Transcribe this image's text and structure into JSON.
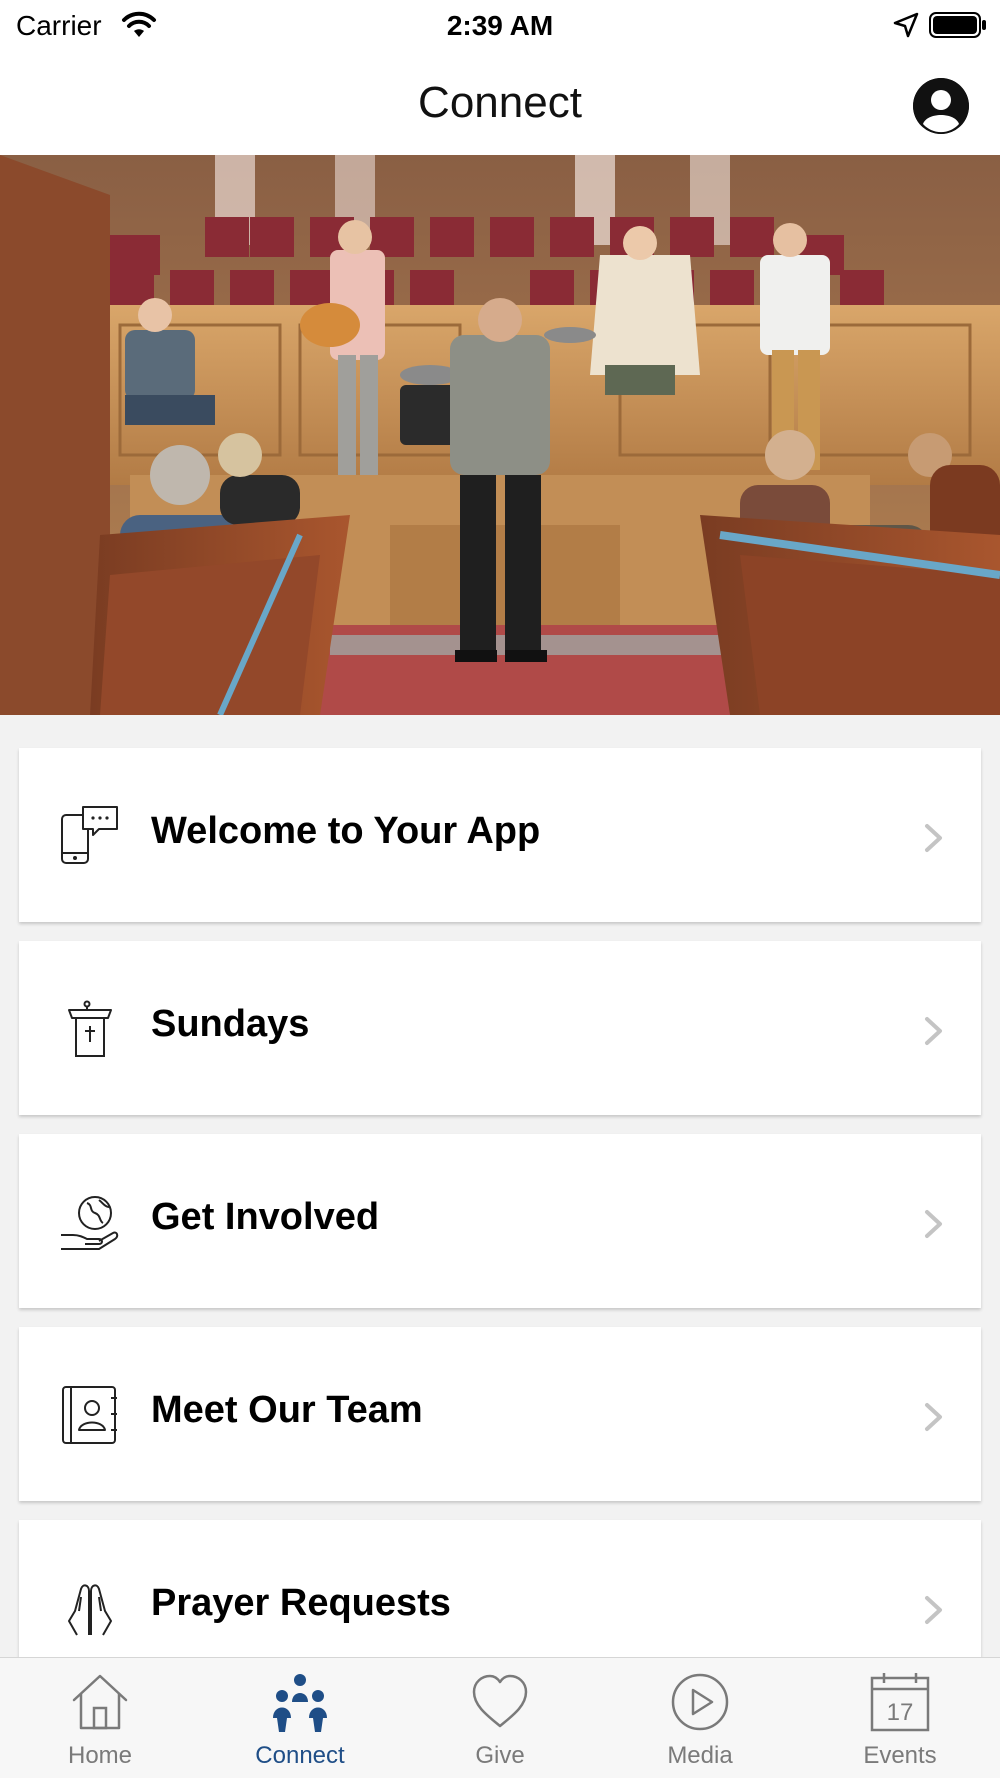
{
  "status_bar": {
    "carrier": "Carrier",
    "time": "2:39 AM"
  },
  "nav": {
    "title": "Connect"
  },
  "hero": {
    "description_icon": "worship-stage-photo"
  },
  "menu": {
    "items": [
      {
        "label": "Welcome to Your App",
        "icon": "phone-chat-icon"
      },
      {
        "label": "Sundays",
        "icon": "pulpit-icon"
      },
      {
        "label": "Get Involved",
        "icon": "globe-hand-icon"
      },
      {
        "label": "Meet Our Team",
        "icon": "contact-book-icon"
      },
      {
        "label": "Prayer Requests",
        "icon": "praying-hands-icon"
      }
    ]
  },
  "tabs": [
    {
      "label": "Home",
      "icon": "home-icon",
      "active": false
    },
    {
      "label": "Connect",
      "icon": "people-icon",
      "active": true
    },
    {
      "label": "Give",
      "icon": "heart-icon",
      "active": false
    },
    {
      "label": "Media",
      "icon": "play-icon",
      "active": false
    },
    {
      "label": "Events",
      "icon": "calendar-icon",
      "active": false,
      "day": "17"
    }
  ],
  "colors": {
    "accent": "#1f4e87",
    "inactive": "#7a7a7a",
    "background": "#f2f2f2"
  }
}
